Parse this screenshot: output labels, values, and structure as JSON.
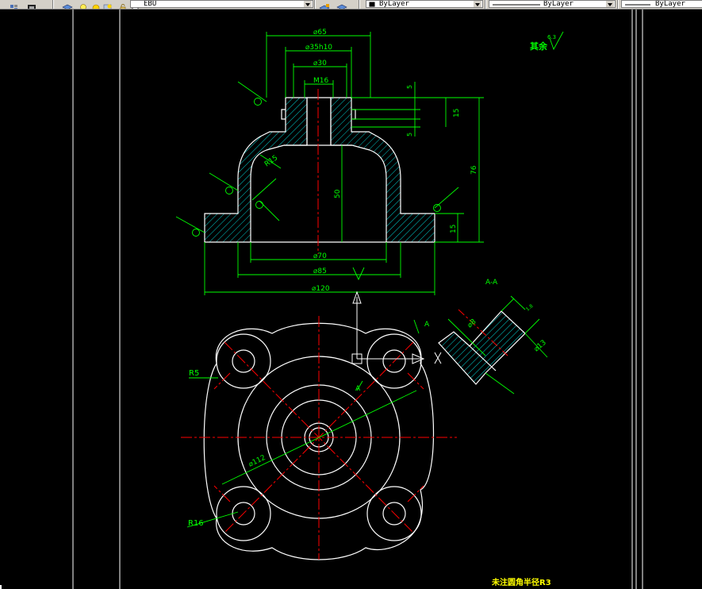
{
  "toolbar": {
    "layer_name": "EBU",
    "color_control": "ByLayer",
    "linetype_control": "ByLayer",
    "lineweight_control": "ByLayer"
  },
  "drawing": {
    "roughness_note": "其余",
    "roughness_value": "6.3",
    "dim_d65": "⌀65",
    "dim_d35h10": "⌀35h10",
    "dim_d30": "⌀30",
    "dim_m16": "M16",
    "dim_5a": "5",
    "dim_5b": "5",
    "dim_15_top": "15",
    "dim_76": "76",
    "dim_r15": "R15",
    "dim_50": "50",
    "dim_15_bottom": "15",
    "dim_d70": "⌀70",
    "dim_d85": "⌀85",
    "dim_d120": "⌀120",
    "section_label": "A-A",
    "section_dim_d8": "⌀8",
    "section_dim_d13": "⌀13",
    "section_dim_small": "1.8",
    "cut_label_a1": "A",
    "cut_label_a2": "A",
    "dim_r5": "R5",
    "dim_d112": "⌀112",
    "dim_r16": "R16",
    "bottom_note": "未注圆角半径R3"
  },
  "colors": {
    "outline": "#ffffff",
    "dimension": "#00ff00",
    "centerline": "#ff0000",
    "hatch": "#00c8c8",
    "label": "#ffff00",
    "background": "#000000"
  }
}
